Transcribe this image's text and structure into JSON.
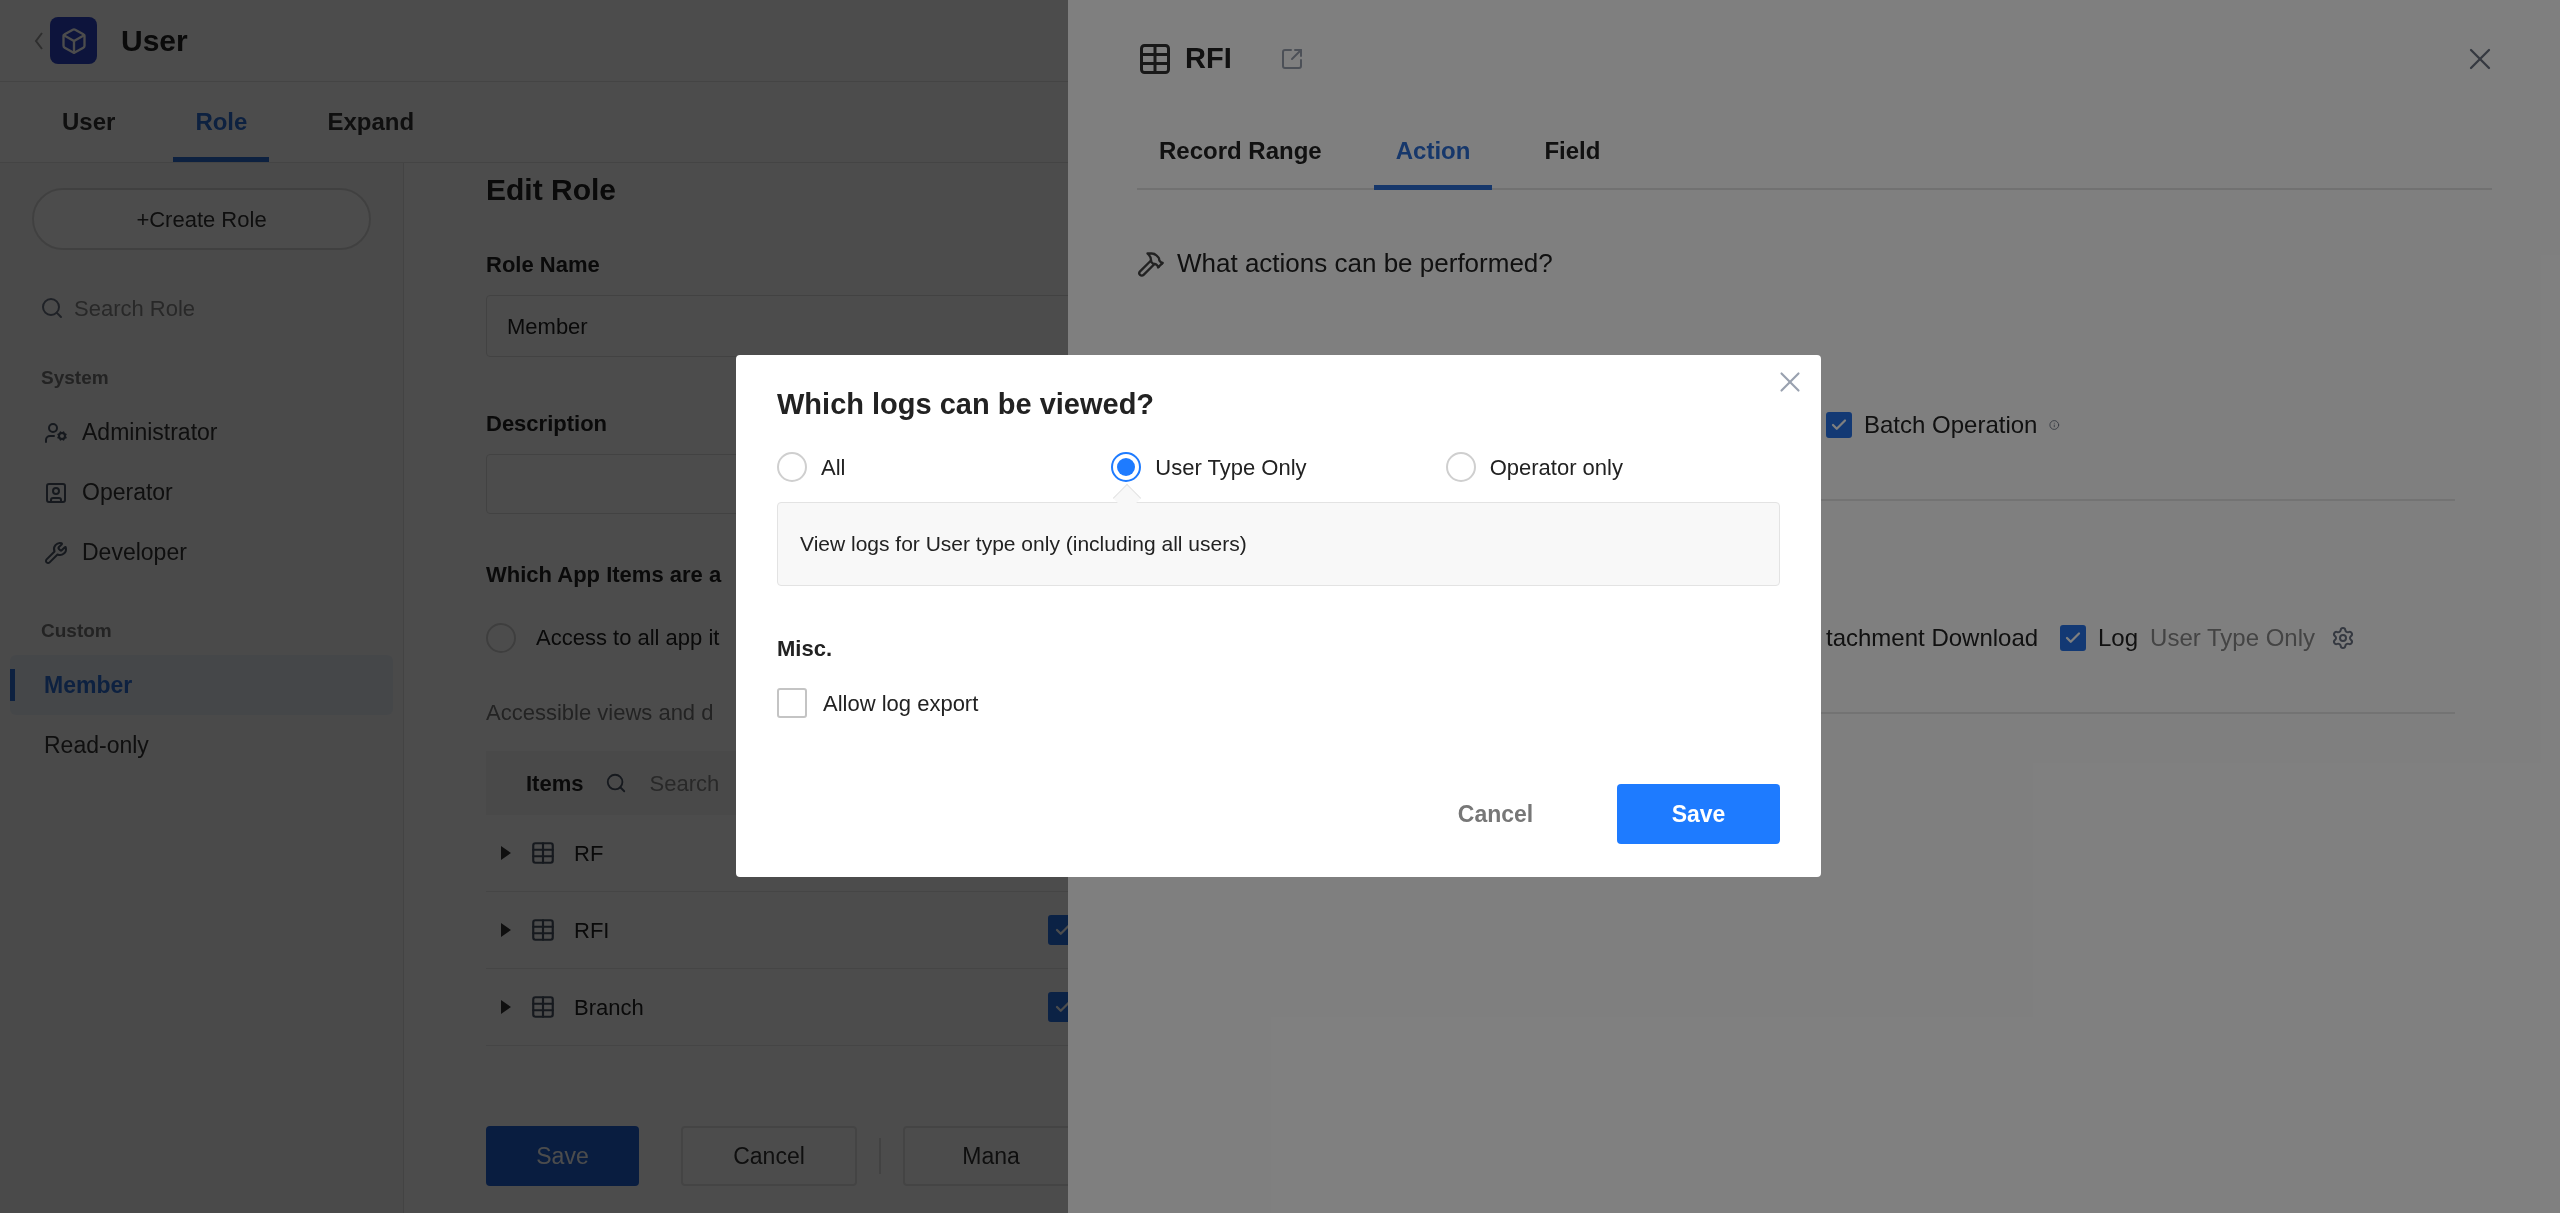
{
  "app": {
    "title": "User",
    "tabs": [
      {
        "label": "User",
        "selected": false
      },
      {
        "label": "Role",
        "selected": true
      },
      {
        "label": "Expand",
        "selected": false
      }
    ]
  },
  "sidebar": {
    "create_button": "+Create Role",
    "search_placeholder": "Search Role",
    "groups": [
      {
        "title": "System",
        "items": [
          {
            "label": "Administrator",
            "selected": false
          },
          {
            "label": "Operator",
            "selected": false
          },
          {
            "label": "Developer",
            "selected": false
          }
        ]
      },
      {
        "title": "Custom",
        "items": [
          {
            "label": "Member",
            "selected": true
          },
          {
            "label": "Read-only",
            "selected": false
          }
        ]
      }
    ]
  },
  "editor": {
    "heading": "Edit Role",
    "role_name": {
      "label": "Role Name",
      "value": "Member"
    },
    "description": {
      "label": "Description"
    },
    "items_question": "Which App Items are a",
    "access_option": {
      "label": "Access to all app it",
      "selected": false
    },
    "accessible_note": "Accessible views and d",
    "items_table": {
      "header": "Items",
      "search_placeholder": "Search",
      "rows": [
        {
          "name": "RF"
        },
        {
          "name": "RFI",
          "checked": true
        },
        {
          "name": "Branch",
          "checked": true
        }
      ]
    },
    "buttons": [
      {
        "label": "Save",
        "kind": "primary"
      },
      {
        "label": "Cancel",
        "kind": "secondary"
      },
      {
        "label": "Mana",
        "kind": "secondary"
      }
    ]
  },
  "drawer": {
    "title": "RFI",
    "tabs": [
      {
        "label": "Record Range",
        "selected": false
      },
      {
        "label": "Action",
        "selected": true
      },
      {
        "label": "Field",
        "selected": false
      }
    ],
    "question": "What actions can be performed?",
    "rows": [
      [
        {
          "label": "Batch Operation",
          "checked": true,
          "info": true
        }
      ],
      [
        {
          "label": "tachment Download"
        },
        {
          "label": "Log",
          "checked": true,
          "note": "User Type Only",
          "settings": true
        }
      ]
    ]
  },
  "modal": {
    "title": "Which logs can be viewed?",
    "options": [
      {
        "label": "All",
        "selected": false
      },
      {
        "label": "User Type Only",
        "selected": true
      },
      {
        "label": "Operator only",
        "selected": false
      }
    ],
    "description": "View logs for User type only (including all users)",
    "misc_title": "Misc.",
    "misc_options": [
      {
        "label": "Allow log export",
        "checked": false
      }
    ],
    "buttons": [
      {
        "label": "Cancel",
        "kind": "secondary"
      },
      {
        "label": "Save",
        "kind": "primary"
      }
    ]
  }
}
